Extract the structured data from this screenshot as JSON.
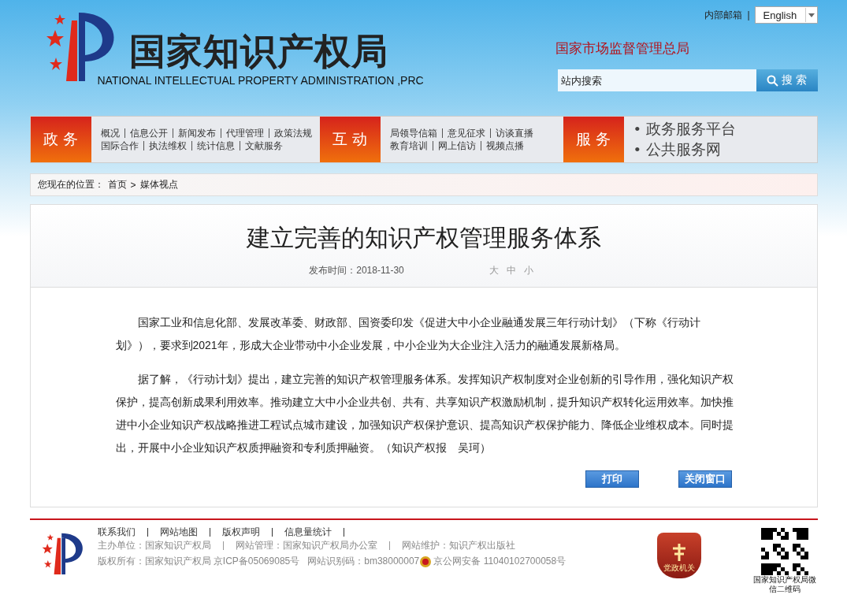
{
  "header": {
    "logo_cn": "国家知识产权局",
    "logo_en": "NATIONAL INTELLECTUAL PROPERTY ADMINISTRATION ,PRC",
    "mail_link": "内部邮箱",
    "mail_sep": "|",
    "language": "English",
    "parent_org": "国家市场监督管理总局",
    "search": {
      "placeholder": "站内搜索",
      "button": "搜 索"
    }
  },
  "nav": [
    {
      "title": "政 务",
      "kind": "links",
      "lines": [
        {
          "links": [
            "概况",
            "信息公开",
            "新闻发布",
            "代理管理",
            "政策法规"
          ]
        },
        {
          "links": [
            "国际合作",
            "执法维权",
            "统计信息",
            "文献服务"
          ]
        }
      ]
    },
    {
      "title": "互 动",
      "kind": "links",
      "lines": [
        {
          "links": [
            "局领导信箱",
            "意见征求",
            "访谈直播"
          ]
        },
        {
          "links": [
            "教育培训",
            "网上信访",
            "视频点播"
          ]
        }
      ]
    },
    {
      "title": "服 务",
      "kind": "bullets",
      "items": [
        {
          "bullet": "•",
          "label": "政务服务平台"
        },
        {
          "bullet": "•",
          "label": "公共服务网"
        }
      ]
    }
  ],
  "breadcrumb": {
    "label": "您现在的位置：",
    "items": [
      "首页",
      "媒体视点"
    ],
    "separator": ">"
  },
  "article": {
    "title": "建立完善的知识产权管理服务体系",
    "date": "发布时间：2018-11-30",
    "font_sizes": [
      "大",
      "中",
      "小"
    ],
    "paragraphs": [
      "国家工业和信息化部、发展改革委、财政部、国资委印发《促进大中小企业融通发展三年行动计划》（下称《行动计划》），要求到2021年，形成大企业带动中小企业发展，中小企业为大企业注入活力的融通发展新格局。",
      "据了解，《行动计划》提出，建立完善的知识产权管理服务体系。发挥知识产权制度对企业创新的引导作用，强化知识产权保护，提高创新成果利用效率。推动建立大中小企业共创、共有、共享知识产权激励机制，提升知识产权转化运用效率。加快推进中小企业知识产权战略推进工程试点城市建设，加强知识产权保护意识、提高知识产权保护能力、降低企业维权成本。同时提出，开展中小企业知识产权质押融资和专利质押融资。（知识产权报　吴珂）"
    ],
    "buttons": [
      "打印",
      "关闭窗口"
    ]
  },
  "footer": {
    "links": [
      "联系我们",
      "网站地图",
      "版权声明",
      "信息量统计"
    ],
    "info_line": [
      "主办单位：国家知识产权局",
      "网站管理：国家知识产权局办公室",
      "网站维护：知识产权出版社"
    ],
    "copyright": "版权所有：国家知识产权局 京ICP备05069085号",
    "site_id": "网站识别码：bm38000007",
    "police": "京公网安备 11040102700058号",
    "badge": "党政机关",
    "qr_caption": "国家知识产权局微信二维码"
  }
}
